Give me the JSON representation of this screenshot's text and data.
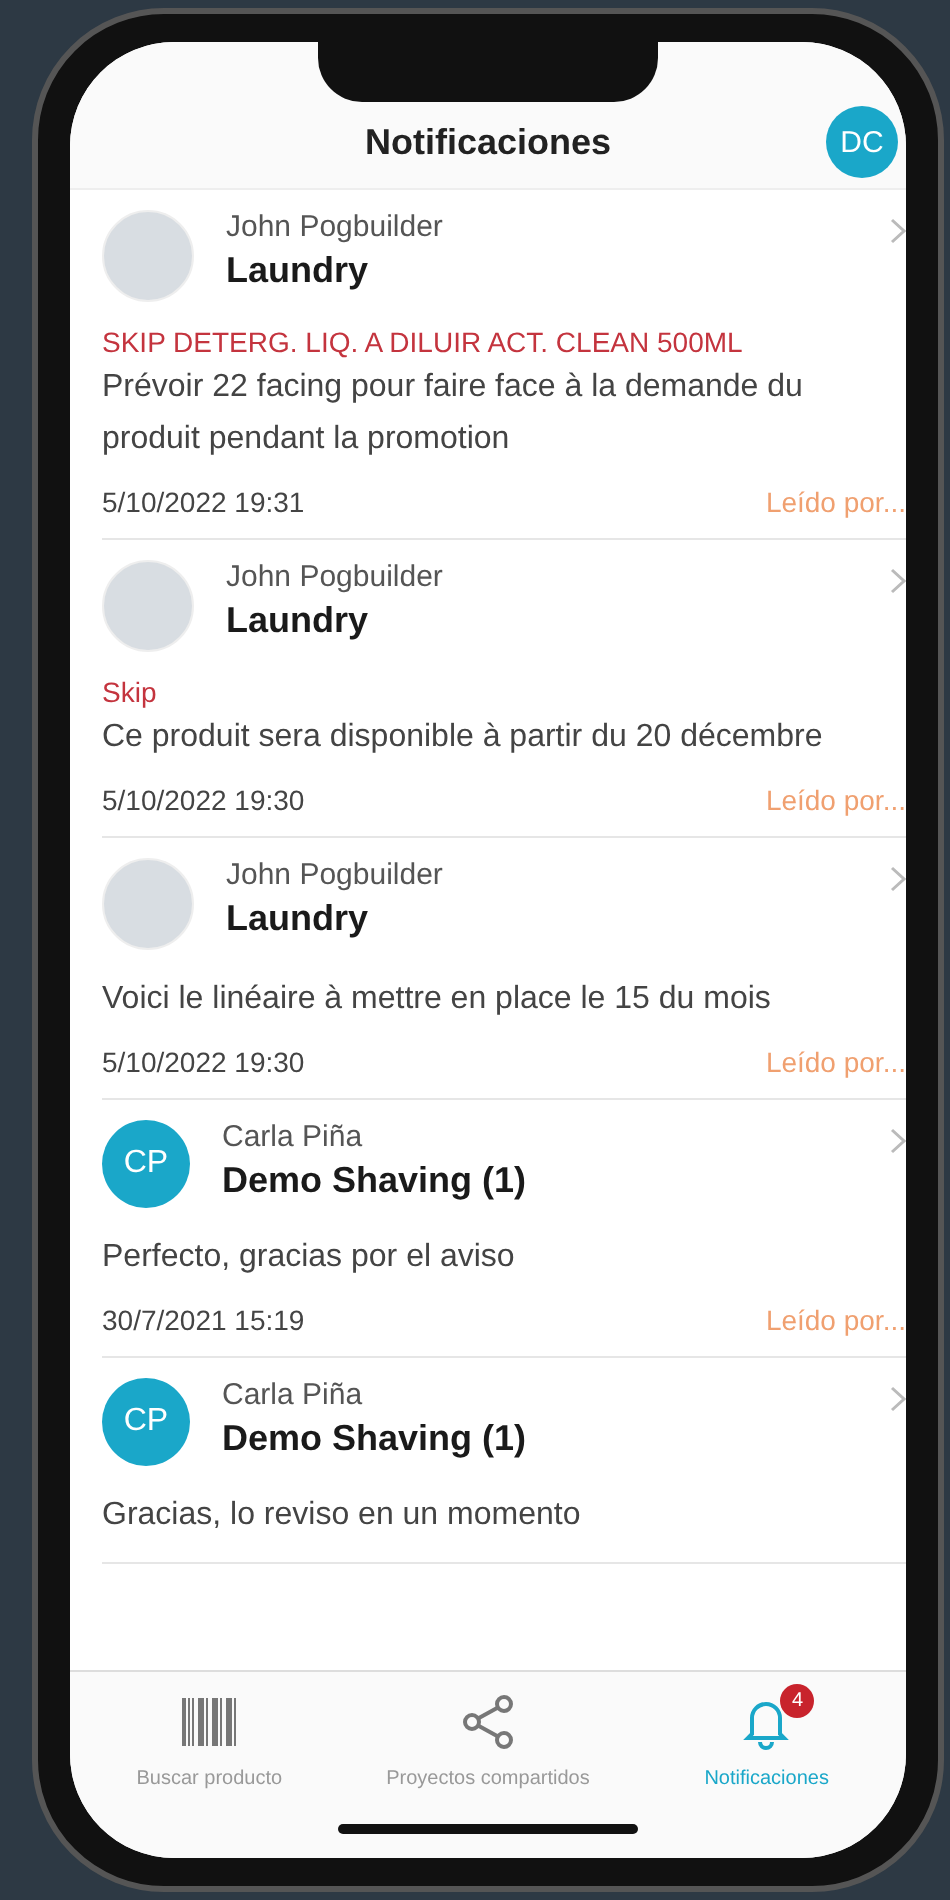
{
  "header": {
    "title": "Notificaciones",
    "user_initials": "DC"
  },
  "notifications": [
    {
      "avatar": {
        "kind": "photo"
      },
      "sender": "John Pogbuilder",
      "project": "Laundry",
      "tag": "SKIP DETERG. LIQ. A DILUIR ACT. CLEAN 500ML",
      "message": "Prévoir 22 facing pour faire face à la demande du produit pendant la promotion",
      "date": "5/10/2022 19:31",
      "read_link": "Leído por..."
    },
    {
      "avatar": {
        "kind": "photo"
      },
      "sender": "John Pogbuilder",
      "project": "Laundry",
      "tag": "Skip",
      "message": "Ce produit sera disponible à partir du 20 décembre",
      "date": "5/10/2022 19:30",
      "read_link": "Leído por..."
    },
    {
      "avatar": {
        "kind": "photo"
      },
      "sender": "John Pogbuilder",
      "project": "Laundry",
      "message": "Voici le linéaire à mettre en place le 15 du mois",
      "date": "5/10/2022 19:30",
      "read_link": "Leído por..."
    },
    {
      "avatar": {
        "kind": "initials",
        "text": "CP"
      },
      "sender": "Carla Piña",
      "project": "Demo Shaving (1)",
      "message": "Perfecto, gracias por el aviso",
      "date": "30/7/2021 15:19",
      "read_link": "Leído por..."
    },
    {
      "avatar": {
        "kind": "initials",
        "text": "CP"
      },
      "sender": "Carla Piña",
      "project": "Demo Shaving (1)",
      "message": "Gracias, lo reviso en un momento"
    }
  ],
  "tabs": [
    {
      "kind": "barcode",
      "label": "Buscar producto",
      "selected": false
    },
    {
      "kind": "share",
      "label": "Proyectos compartidos",
      "selected": false
    },
    {
      "kind": "bell",
      "label": "Notificaciones",
      "selected": true,
      "badge": "4"
    }
  ]
}
